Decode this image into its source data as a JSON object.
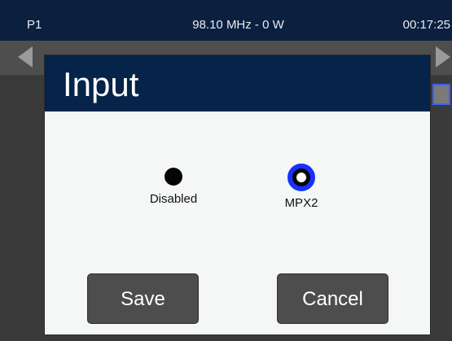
{
  "status_bar": {
    "preset": "P1",
    "frequency_power": "98.10 MHz - 0 W",
    "time": "00:17:25"
  },
  "dialog": {
    "title": "Input",
    "options": [
      {
        "label": "Disabled",
        "selected": false
      },
      {
        "label": "MPX2",
        "selected": true
      }
    ],
    "save_label": "Save",
    "cancel_label": "Cancel"
  },
  "colors": {
    "header_bg": "#062349",
    "status_bg": "#0b1f3e",
    "selected_ring": "#1531ff",
    "button_bg": "#4d4d4d"
  },
  "icons": {
    "nav_left": "arrow-left-icon",
    "nav_right": "arrow-right-icon"
  }
}
